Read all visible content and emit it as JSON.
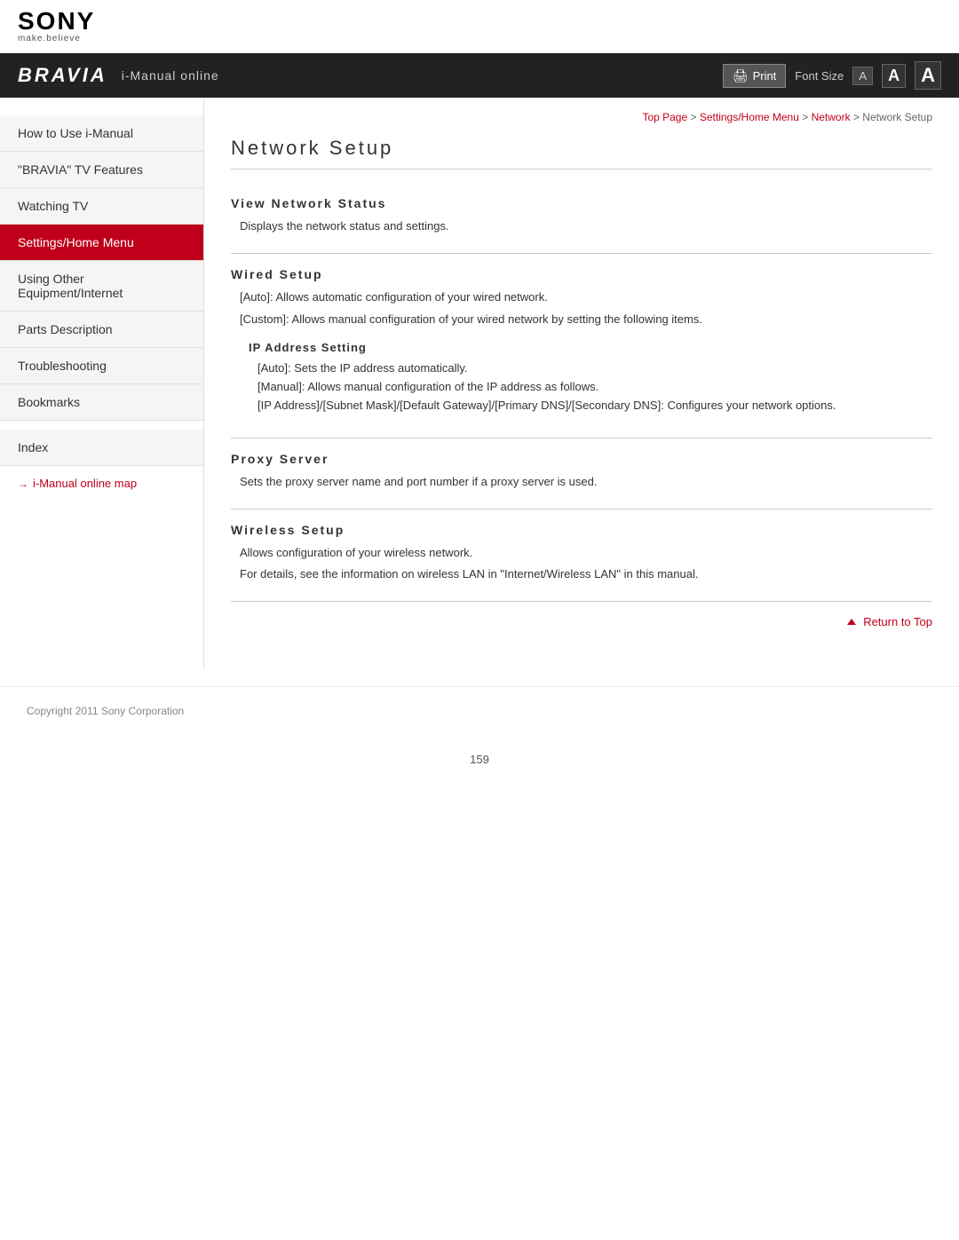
{
  "header": {
    "sony_text": "SONY",
    "tagline": "make.believe",
    "bravia_logo": "BRAVIA",
    "i_manual_label": "i-Manual online",
    "print_button": "Print",
    "font_size_label": "Font Size",
    "font_a_small": "A",
    "font_a_medium": "A",
    "font_a_large": "A"
  },
  "breadcrumb": {
    "top_page": "Top Page",
    "separator1": " > ",
    "settings": "Settings/Home Menu",
    "separator2": " > ",
    "network": "Network",
    "separator3": " > ",
    "current": "Network Setup"
  },
  "sidebar": {
    "items": [
      {
        "label": "How to Use i-Manual",
        "active": false
      },
      {
        "label": "\"BRAVIA\" TV Features",
        "active": false
      },
      {
        "label": "Watching TV",
        "active": false
      },
      {
        "label": "Settings/Home Menu",
        "active": true
      },
      {
        "label": "Using Other Equipment/Internet",
        "active": false
      },
      {
        "label": "Parts Description",
        "active": false
      },
      {
        "label": "Troubleshooting",
        "active": false
      },
      {
        "label": "Bookmarks",
        "active": false
      }
    ],
    "index_label": "Index",
    "link_label": "i-Manual online map"
  },
  "page": {
    "title": "Network Setup",
    "sections": [
      {
        "id": "view-network-status",
        "title": "View  Network  Status",
        "body": "Displays the network status and settings.",
        "sub_sections": []
      },
      {
        "id": "wired-setup",
        "title": "Wired Setup",
        "body": "[Auto]: Allows automatic configuration of your wired network.\n[Custom]: Allows manual configuration of your wired network by setting the following items.",
        "sub_sections": [
          {
            "title": "IP Address Setting",
            "lines": [
              "[Auto]: Sets the IP address automatically.",
              "[Manual]: Allows manual configuration of the IP address as follows.",
              "[IP Address]/[Subnet Mask]/[Default Gateway]/[Primary DNS]/[Secondary DNS]: Configures your network options."
            ]
          }
        ]
      },
      {
        "id": "proxy-server",
        "title": "Proxy Server",
        "body": "Sets the proxy server name and port number if a proxy server is used.",
        "sub_sections": []
      },
      {
        "id": "wireless-setup",
        "title": "Wireless  Setup",
        "body": "Allows configuration of your wireless network.\nFor details, see the information on wireless LAN in \"Internet/Wireless LAN\" in this manual.",
        "sub_sections": []
      }
    ],
    "return_to_top": "Return to Top"
  },
  "footer": {
    "copyright": "Copyright 2011 Sony Corporation",
    "page_number": "159"
  }
}
